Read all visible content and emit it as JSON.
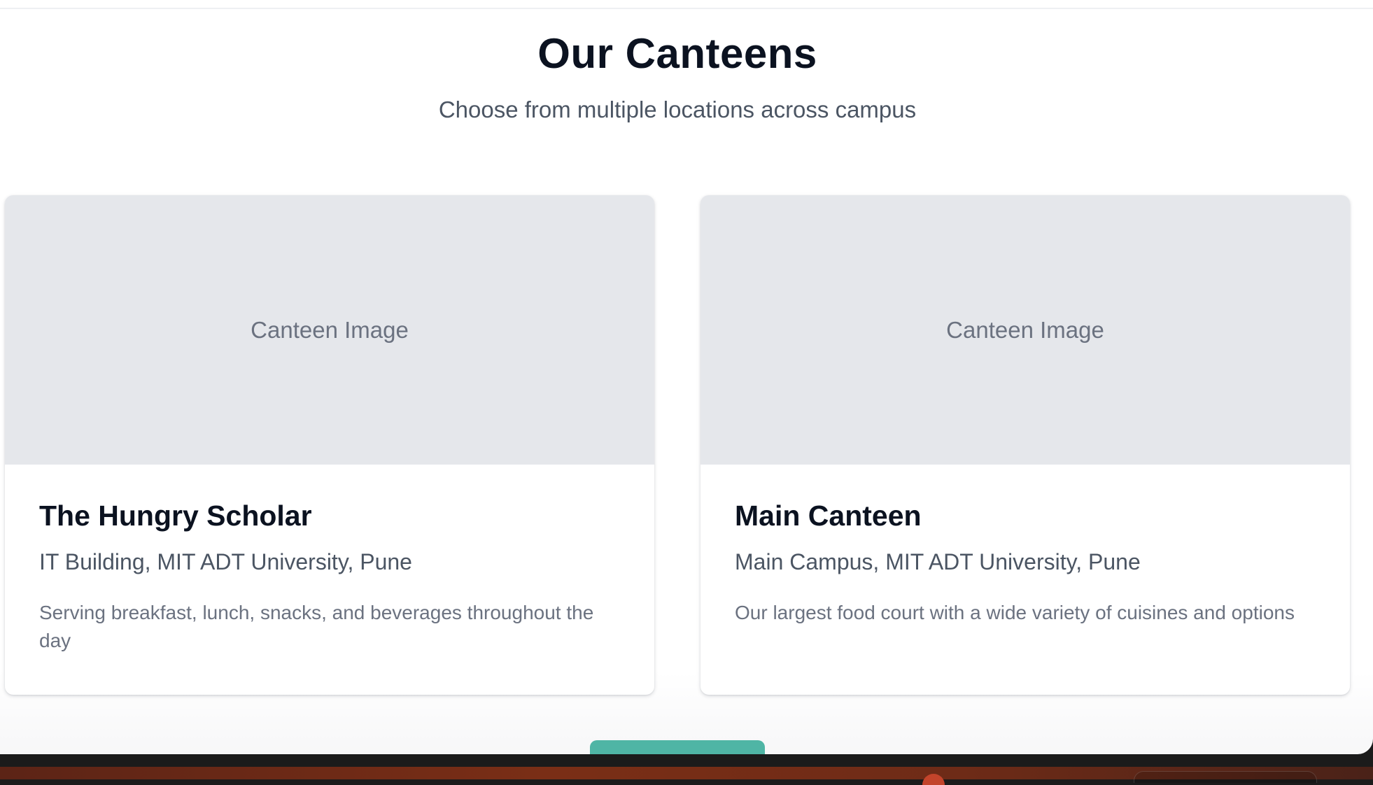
{
  "section": {
    "title": "Our Canteens",
    "subtitle": "Choose from multiple locations across campus"
  },
  "canteens": [
    {
      "image_label": "Canteen Image",
      "name": "The Hungry Scholar",
      "location": "IT Building, MIT ADT University, Pune",
      "description": "Serving breakfast, lunch, snacks, and beverages throughout the day"
    },
    {
      "image_label": "Canteen Image",
      "name": "Main Canteen",
      "location": "Main Campus, MIT ADT University, Pune",
      "description": "Our largest food court with a wide variety of cuisines and options"
    }
  ],
  "colors": {
    "accent": "#4fb5a5",
    "heading": "#0b1220",
    "image_placeholder": "#e5e7eb"
  }
}
